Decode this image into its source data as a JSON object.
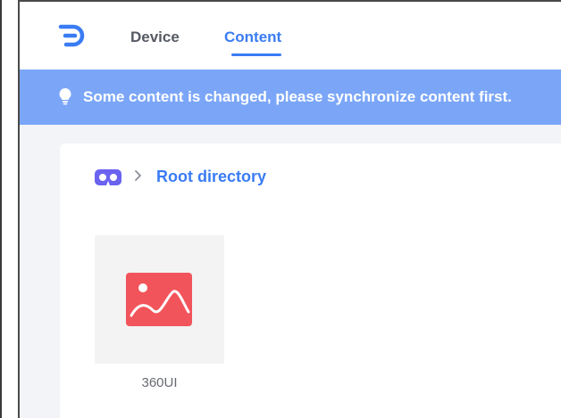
{
  "nav": {
    "logo_icon": "brand-logo-icon",
    "tabs": [
      {
        "label": "Device",
        "active": false
      },
      {
        "label": "Content",
        "active": true
      }
    ]
  },
  "banner": {
    "icon": "lightbulb-icon",
    "message": "Some content is changed, please synchronize content first."
  },
  "breadcrumb": {
    "home_icon": "vr-headset-icon",
    "separator_icon": "chevron-right-icon",
    "current": "Root directory"
  },
  "items": [
    {
      "icon": "image-icon",
      "name": "360UI"
    }
  ],
  "colors": {
    "accent": "#3a7cf4",
    "banner_bg": "#7ba6f8",
    "image_icon": "#f2545b",
    "vr_icon": "#6b63f0"
  }
}
